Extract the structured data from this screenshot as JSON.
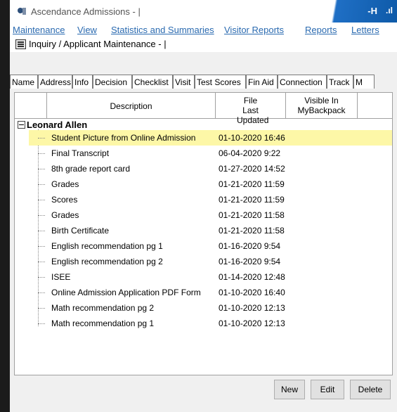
{
  "window": {
    "title": "Ascendance Admissions - |"
  },
  "menu": [
    "Maintenance",
    "View",
    "Statistics and Summaries",
    "Visitor Reports",
    "Reports",
    "Letters"
  ],
  "form": {
    "title": "Inquiry / Applicant Maintenance - |"
  },
  "tabs": [
    "Name",
    "Address",
    "Info",
    "Decision",
    "Checklist",
    "Visit",
    "Test Scores",
    "Fin Aid",
    "Connection",
    "Track",
    "M"
  ],
  "grid": {
    "columns": [
      "Description",
      "File Last Updated",
      "Visible In MyBackpack"
    ],
    "parent": "Leonard Allen",
    "rows": [
      {
        "description": "Student Picture from Online Admission",
        "updated": "01-10-2020 16:46",
        "selected": true
      },
      {
        "description": "Final Transcript",
        "updated": "06-04-2020 9:22"
      },
      {
        "description": "8th grade report card",
        "updated": "01-27-2020 14:52"
      },
      {
        "description": "Grades",
        "updated": "01-21-2020 11:59"
      },
      {
        "description": "Scores",
        "updated": "01-21-2020 11:59"
      },
      {
        "description": "Grades",
        "updated": "01-21-2020 11:58"
      },
      {
        "description": "Birth Certificate",
        "updated": "01-21-2020 11:58"
      },
      {
        "description": "English recommendation pg 1",
        "updated": "01-16-2020 9:54"
      },
      {
        "description": "English recommendation pg 2",
        "updated": "01-16-2020 9:54"
      },
      {
        "description": "ISEE",
        "updated": "01-14-2020 12:48"
      },
      {
        "description": "Online Admission Application PDF Form",
        "updated": "01-10-2020 16:40"
      },
      {
        "description": "Math recommendation pg 2",
        "updated": "01-10-2020 12:13"
      },
      {
        "description": "Math recommendation pg 1",
        "updated": "01-10-2020 12:13"
      }
    ]
  },
  "buttons": {
    "new": "New",
    "edit": "Edit",
    "delete": "Delete"
  },
  "colors": {
    "selected_row": "#fdf7a7",
    "menu_link": "#2a6ab0",
    "titlebar_accent": "#0e5aa8"
  }
}
